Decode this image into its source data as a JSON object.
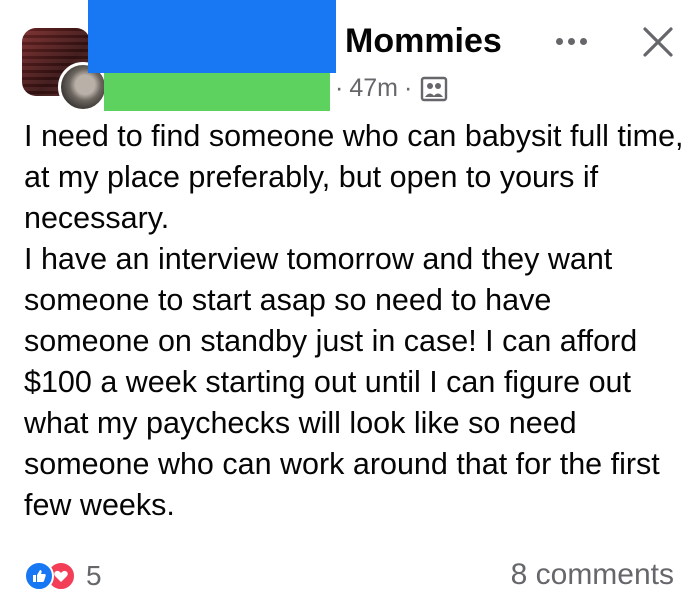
{
  "header": {
    "group_name": "Mommies",
    "time_prefix": "·",
    "time_ago": "47m",
    "separator": "·",
    "audience_icon": "group-audience-icon",
    "more_icon": "more-options-icon",
    "close_icon": "close-icon"
  },
  "post": {
    "paragraphs": [
      "I need to find someone who can babysit full time, at my place preferably, but open to yours if necessary.",
      "I have an interview tomorrow and they want someone to start asap so need to have someone on standby just in case! I can afford $100 a week starting out until I can figure out what my paychecks will look like so need someone who can work around that for the first few weeks."
    ]
  },
  "footer": {
    "reaction_icons": [
      "like-icon",
      "love-icon"
    ],
    "reaction_count": "5",
    "comments_label": "8 comments"
  },
  "colors": {
    "redaction_blue": "#1877f2",
    "redaction_green": "#5ed25f",
    "like_blue": "#1877f2",
    "love_red": "#f33e58",
    "secondary_text": "#65676b"
  }
}
